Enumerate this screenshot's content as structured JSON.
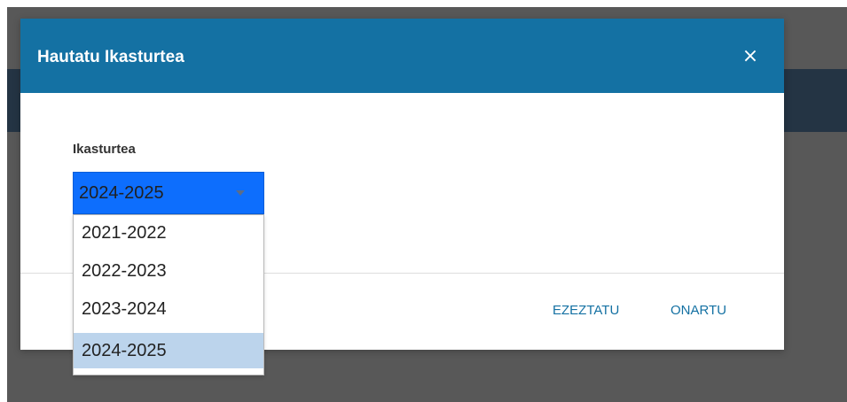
{
  "dialog": {
    "title": "Hautatu Ikasturtea",
    "close_label": "×",
    "field_label": "Ikasturtea",
    "select": {
      "value": "2024-2025",
      "options": [
        "2021-2022",
        "2022-2023",
        "2023-2024",
        "2024-2025"
      ],
      "highlighted_option": "2024-2025"
    },
    "buttons": {
      "cancel": "EZEZTATU",
      "confirm": "ONARTU"
    }
  },
  "colors": {
    "header": "#1471a3",
    "select_focus": "#0d6efd",
    "option_highlight": "#bcd4ec",
    "backdrop": "#585858",
    "button_text": "#1471a3"
  },
  "icons": {
    "close": "close-icon",
    "dropdown": "chevron-down-icon"
  }
}
